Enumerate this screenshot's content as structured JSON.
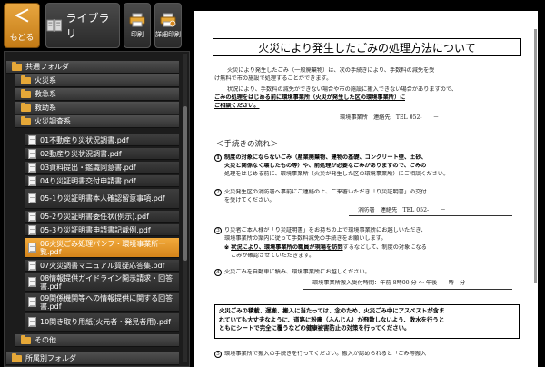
{
  "toolbar": {
    "back_label": "もどる",
    "back_chevron": "＜",
    "library_label": "ライブラリ",
    "print_label": "印刷",
    "detail_print_label": "詳細印刷"
  },
  "sidebar": {
    "items": [
      {
        "type": "folder",
        "label": "共通フォルダ"
      },
      {
        "type": "folder",
        "label": "火災系"
      },
      {
        "type": "folder",
        "label": "救急系"
      },
      {
        "type": "folder",
        "label": "救助系"
      },
      {
        "type": "folder",
        "label": "火災調査系"
      },
      {
        "type": "file",
        "label": "01不動産り災状況調書.pdf"
      },
      {
        "type": "file",
        "label": "02動産り災状況調書.pdf"
      },
      {
        "type": "file",
        "label": "03資料提出・鑑識同意書.pdf"
      },
      {
        "type": "file",
        "label": "04り災証明書交付申請書.pdf"
      },
      {
        "type": "file",
        "label": "05-1り災証明書本人確認留意事項.pdf"
      },
      {
        "type": "file",
        "label": "05-2り災証明書委任状(例示).pdf"
      },
      {
        "type": "file",
        "label": "05-3り災証明書申請書記載例.pdf"
      },
      {
        "type": "file",
        "label": "06火災ごみ処理パンフ・環境事業所一覧.pdf",
        "selected": true
      },
      {
        "type": "file",
        "label": "07火災調書マニュアル質疑応答集.pdf"
      },
      {
        "type": "file",
        "label": "08情報提供ガイドライン開示請求・回答書.pdf"
      },
      {
        "type": "file",
        "label": "09関係機関等への情報提供に関する回答書.pdf"
      },
      {
        "type": "file",
        "label": "10関き取り用紙(火元者・発見者用).pdf"
      },
      {
        "type": "folder",
        "label": "その他"
      },
      {
        "type": "folder",
        "label": "所属別フォルダ"
      }
    ]
  },
  "document": {
    "title": "火災により発生したごみの処理方法について",
    "intro_1": "火災により発生したごみ（一般廃棄物）は、次の手続きにより、手数料の減免を受",
    "intro_2": "け無料で市の施設で処理することができます。",
    "intro_3": "状況により、手数料の減免ができない場合や市の施設に搬入できない場合がありますので、",
    "intro_4_bold": "ごみの処理をはじめる前に環境事業所（火災が発生した区の環境事業所）に",
    "intro_5_bold": "ご相談ください。",
    "contact_1": "環境事業所　連絡先　TEL 052-　　－",
    "section_heading": "＜手続きの流れ＞",
    "step1_a": "制度の対象にならないごみ（産業廃棄物、建物の基礎、コンクリート壁、土砂、",
    "step1_b": "火災と関係なく壊したもの等）や、前処理が必要なごみがありますので、ごみの",
    "step1_c": "処理をはじめる前に、環境事業所（火災が発生した区の環境事業所）にご相談ください。",
    "step2_a": "火災発生区の消防署へ事前にご連絡の上、ご来署いただき「り災証明書」の交付",
    "step2_b": "を受けてください。",
    "contact_2": "消防署　連絡先　TEL 052-　　－",
    "step3_a": "り災者ご本人様が「り災証明書」をお持ちの上で環境事業所にお越しいただき、",
    "step3_b": "環境事業所の案内に従って手数料減免の手続きをお願いします。",
    "step3_c_mark": "※",
    "step3_c_bold": "状況により、環境事業所の職員が現場を訪問",
    "step3_c_rest": "するなどして、制度の対象になる",
    "step3_d": "ごみか確認させていただきます。",
    "step4_a": "火災ごみを自動車に積み、環境事業所にお越しください。",
    "step4_b": "環境事業所搬入受付時間：午前 8時00 分 ～ 午後　　時　分",
    "note_1": "火災ごみの積載、運搬、搬入に当たっては、念のため、火災ごみ中にアスベストが含ま",
    "note_2": "れていても大丈夫なように、道路に粉塵（ふんじん）が飛散しないよう、散水を行うと",
    "note_3": "ともにシートで完全に覆うなどの健康被害防止の対策を行ってください。",
    "step5_a": "環境事業所で搬入の手続きを行ってください。搬入が認められると「ごみ等搬入"
  },
  "colors": {
    "accent_orange": "#e59a2c",
    "toolbar_bg": "#000000",
    "sidebar_bg": "#1c1c1c"
  }
}
